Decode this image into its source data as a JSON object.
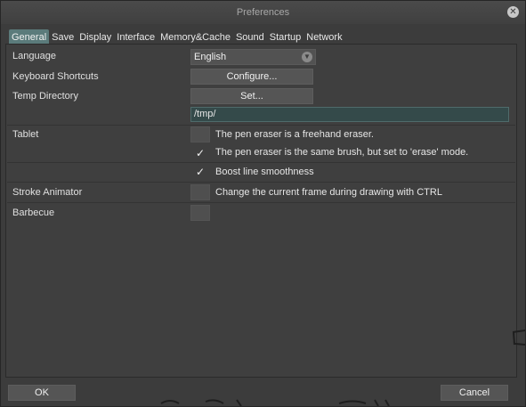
{
  "window": {
    "title": "Preferences"
  },
  "tabs": [
    {
      "label": "General",
      "active": true
    },
    {
      "label": "Save",
      "active": false
    },
    {
      "label": "Display",
      "active": false
    },
    {
      "label": "Interface",
      "active": false
    },
    {
      "label": "Memory&Cache",
      "active": false
    },
    {
      "label": "Sound",
      "active": false
    },
    {
      "label": "Startup",
      "active": false
    },
    {
      "label": "Network",
      "active": false
    }
  ],
  "general": {
    "language": {
      "label": "Language",
      "value": "English"
    },
    "keyboard_shortcuts": {
      "label": "Keyboard Shortcuts",
      "button": "Configure..."
    },
    "temp_directory": {
      "label": "Temp Directory",
      "button": "Set...",
      "path": "/tmp/"
    },
    "tablet": {
      "label": "Tablet",
      "options": [
        {
          "label": "The pen eraser is a freehand eraser.",
          "checked": false
        },
        {
          "label": "The pen eraser is the same brush, but set to 'erase' mode.",
          "checked": true
        },
        {
          "label": "Boost line smoothness",
          "checked": true
        }
      ]
    },
    "stroke_animator": {
      "label": "Stroke Animator",
      "option": {
        "label": "Change the current frame during drawing with CTRL",
        "checked": false
      }
    },
    "barbecue": {
      "label": "Barbecue",
      "checked": false
    }
  },
  "footer": {
    "ok": "OK",
    "cancel": "Cancel"
  },
  "icons": {
    "close": "close-icon",
    "combo_arrow": "chevron-down-icon",
    "check": "checkmark-icon"
  },
  "colors": {
    "active_tab": "#5b7b7b",
    "path_field": "#344a4a",
    "background": "#3c3c3c"
  }
}
